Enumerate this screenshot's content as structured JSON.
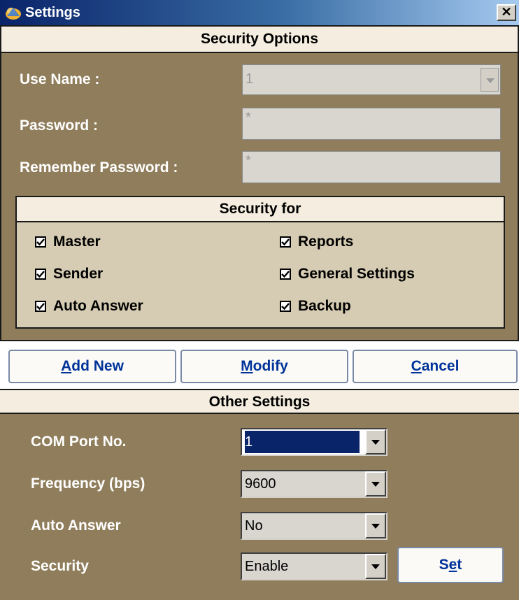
{
  "window": {
    "title": "Settings",
    "close_glyph": "✕"
  },
  "security_options": {
    "header": "Security Options",
    "user_name": {
      "label": "Use Name :",
      "value": "1"
    },
    "password": {
      "label": "Password :",
      "value": "*"
    },
    "remember_password": {
      "label": "Remember Password :",
      "value": "*"
    }
  },
  "security_for": {
    "header": "Security for",
    "items": [
      {
        "label": "Master",
        "checked": true
      },
      {
        "label": "Reports",
        "checked": true
      },
      {
        "label": "Sender",
        "checked": true
      },
      {
        "label": "General Settings",
        "checked": true
      },
      {
        "label": "Auto Answer",
        "checked": true
      },
      {
        "label": "Backup",
        "checked": true
      }
    ]
  },
  "actions": {
    "add_new": {
      "mnemonic": "A",
      "rest": "dd New"
    },
    "modify": {
      "mnemonic": "M",
      "rest": "odify"
    },
    "cancel": {
      "mnemonic": "C",
      "rest": "ancel"
    }
  },
  "other_settings": {
    "header": "Other Settings",
    "com_port": {
      "label": "COM Port No.",
      "value": "1"
    },
    "frequency": {
      "label": "Frequency (bps)",
      "value": "9600"
    },
    "auto_answer": {
      "label": "Auto Answer",
      "value": "No"
    },
    "security": {
      "label": "Security",
      "value": "Enable"
    },
    "set_button": {
      "pre": "S",
      "mnemonic": "e",
      "post": "t"
    }
  },
  "colors": {
    "panel": "#8f7d5b",
    "header": "#f5eee0",
    "security_for_bg": "#d6ccb3",
    "button_text": "#003399",
    "highlight": "#0a246a"
  }
}
